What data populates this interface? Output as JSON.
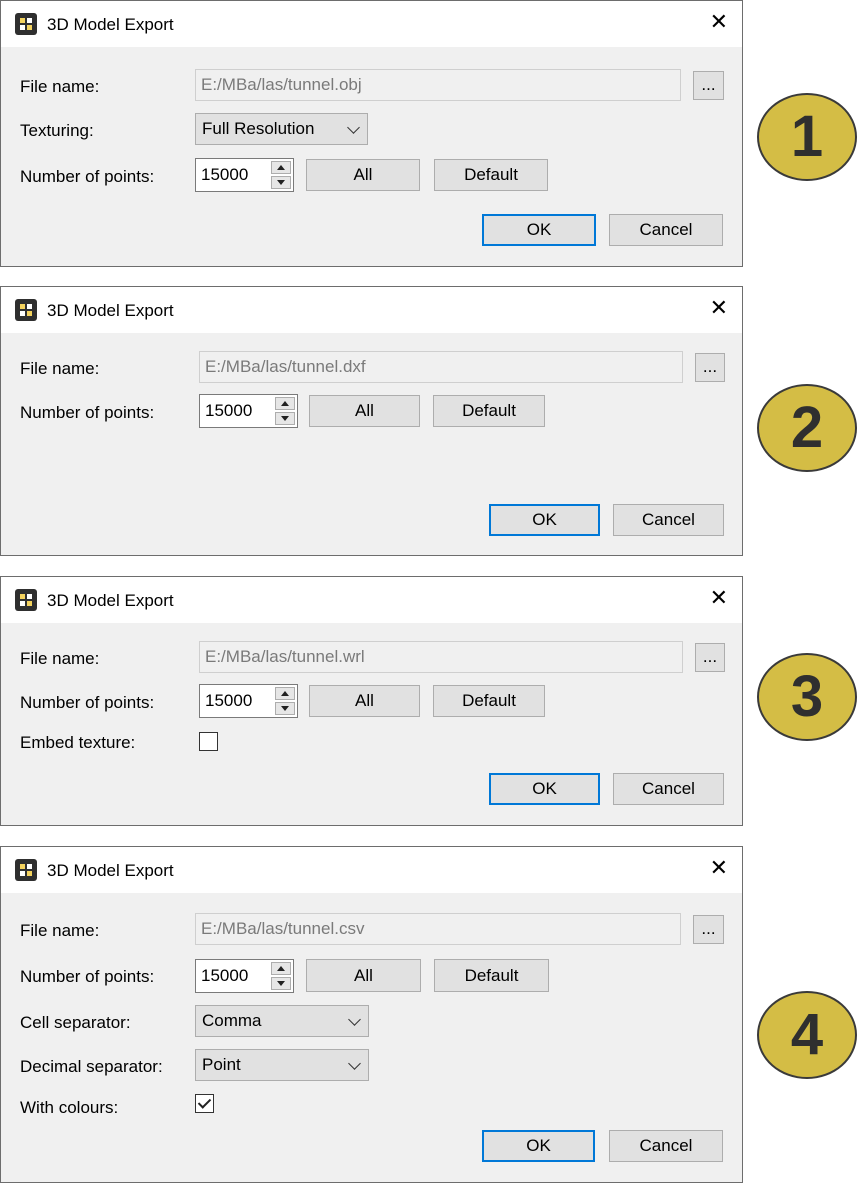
{
  "dialogs": [
    {
      "title": "3D Model Export",
      "file_label": "File name:",
      "file_value": "E:/MBa/las/tunnel.obj",
      "browse": "...",
      "texturing_label": "Texturing:",
      "texturing_value": "Full Resolution",
      "points_label": "Number of points:",
      "points_value": "15000",
      "all_label": "All",
      "default_label": "Default",
      "ok_label": "OK",
      "cancel_label": "Cancel",
      "badge": "1"
    },
    {
      "title": "3D Model Export",
      "file_label": "File name:",
      "file_value": "E:/MBa/las/tunnel.dxf",
      "browse": "...",
      "points_label": "Number of points:",
      "points_value": "15000",
      "all_label": "All",
      "default_label": "Default",
      "ok_label": "OK",
      "cancel_label": "Cancel",
      "badge": "2"
    },
    {
      "title": "3D Model Export",
      "file_label": "File name:",
      "file_value": "E:/MBa/las/tunnel.wrl",
      "browse": "...",
      "points_label": "Number of points:",
      "points_value": "15000",
      "all_label": "All",
      "default_label": "Default",
      "embed_label": "Embed texture:",
      "embed_checked": false,
      "ok_label": "OK",
      "cancel_label": "Cancel",
      "badge": "3"
    },
    {
      "title": "3D Model Export",
      "file_label": "File name:",
      "file_value": "E:/MBa/las/tunnel.csv",
      "browse": "...",
      "points_label": "Number of points:",
      "points_value": "15000",
      "all_label": "All",
      "default_label": "Default",
      "cell_label": "Cell separator:",
      "cell_value": "Comma",
      "decimal_label": "Decimal separator:",
      "decimal_value": "Point",
      "colours_label": "With colours:",
      "colours_checked": true,
      "ok_label": "OK",
      "cancel_label": "Cancel",
      "badge": "4"
    }
  ],
  "colors": {
    "dialog_bg": "#f0f0f0",
    "titlebar_bg": "#ffffff",
    "button_bg": "#e1e1e1",
    "focus_border": "#0078d7",
    "badge_fill": "#d4bd45"
  },
  "icons": {
    "app": "app-icon",
    "close": "close-icon",
    "dropdown": "chevron-down-icon",
    "spin_up": "spin-up-icon",
    "spin_down": "spin-down-icon",
    "check": "checkmark-icon"
  },
  "glyphs": {
    "close": "✕"
  }
}
